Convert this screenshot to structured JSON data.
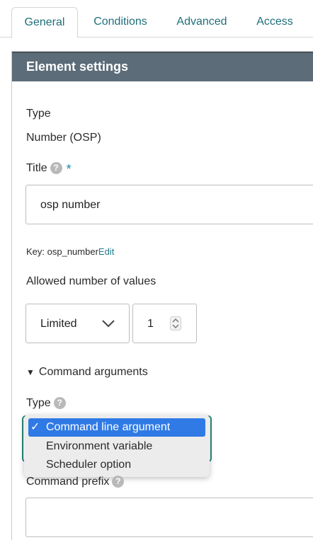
{
  "tabs": [
    {
      "label": "General",
      "active": true
    },
    {
      "label": "Conditions",
      "active": false
    },
    {
      "label": "Advanced",
      "active": false
    },
    {
      "label": "Access",
      "active": false
    }
  ],
  "panel": {
    "title": "Element settings",
    "type_label": "Type",
    "type_value": "Number (OSP)",
    "title_label": "Title",
    "title_required": "*",
    "title_value": "osp number",
    "key_prefix": "Key: ",
    "key_value": "osp_number",
    "key_edit": "Edit",
    "allowed_label": "Allowed number of values",
    "allowed_select_value": "Limited",
    "allowed_count": "1",
    "command_section_label": "Command arguments",
    "command_section_marker": "▼",
    "command_type_label": "Type",
    "command_prefix_label": "Command prefix",
    "command_prefix_value": ""
  },
  "dropdown": {
    "options": [
      {
        "label": "Command line argument",
        "selected": true
      },
      {
        "label": "Environment variable",
        "selected": false
      },
      {
        "label": "Scheduler option",
        "selected": false
      }
    ],
    "checkmark": "✓"
  },
  "help_glyph": "?",
  "colors": {
    "accent": "#1f6f7a",
    "header_bg": "#5c6c78",
    "selected_option": "#2f7ae5",
    "focus_ring": "#2a8a7a"
  }
}
